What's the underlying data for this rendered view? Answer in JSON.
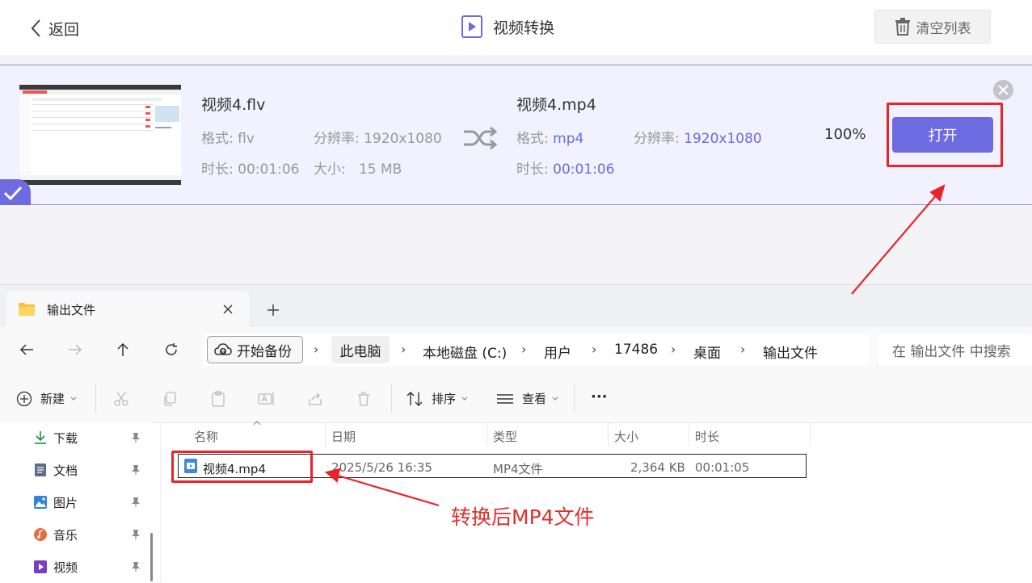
{
  "app": {
    "back_label": "返回",
    "title": "视频转换",
    "clear_label": "清空列表"
  },
  "conversion": {
    "source": {
      "filename": "视频4.flv",
      "format_label": "格式:",
      "format": "flv",
      "resolution_label": "分辨率:",
      "resolution": "1920x1080",
      "duration_label": "时长:",
      "duration": "00:01:06",
      "size_label": "大小:",
      "size": "15 MB"
    },
    "output": {
      "filename": "视频4.mp4",
      "format_label": "格式:",
      "format": "mp4",
      "resolution_label": "分辨率:",
      "resolution": "1920x1080",
      "duration_label": "时长:",
      "duration": "00:01:06"
    },
    "progress": "100%",
    "progress_value": 1.0,
    "open_label": "打开",
    "accent_color": "#6d6bdf"
  },
  "explorer": {
    "tab_title": "输出文件",
    "nav": {
      "backup_label": "开始备份",
      "breadcrumbs": [
        "此电脑",
        "本地磁盘 (C:)",
        "用户",
        "17486",
        "桌面",
        "输出文件"
      ],
      "search_placeholder": "在 输出文件 中搜索"
    },
    "commands": {
      "new_label": "新建",
      "sort_label": "排序",
      "view_label": "查看",
      "more_label": "···"
    },
    "sidebar": [
      {
        "label": "下载",
        "icon": "download-icon"
      },
      {
        "label": "文档",
        "icon": "document-icon"
      },
      {
        "label": "图片",
        "icon": "picture-icon"
      },
      {
        "label": "音乐",
        "icon": "music-icon"
      },
      {
        "label": "视频",
        "icon": "video-icon"
      }
    ],
    "columns": [
      "名称",
      "日期",
      "类型",
      "大小",
      "时长"
    ],
    "files": [
      {
        "name": "视频4.mp4",
        "date": "2025/5/26 16:35",
        "type": "MP4文件",
        "size": "2,364 KB",
        "duration": "00:01:05"
      }
    ]
  },
  "annotation": {
    "text": "转换后MP4文件",
    "color": "#e8242b"
  }
}
